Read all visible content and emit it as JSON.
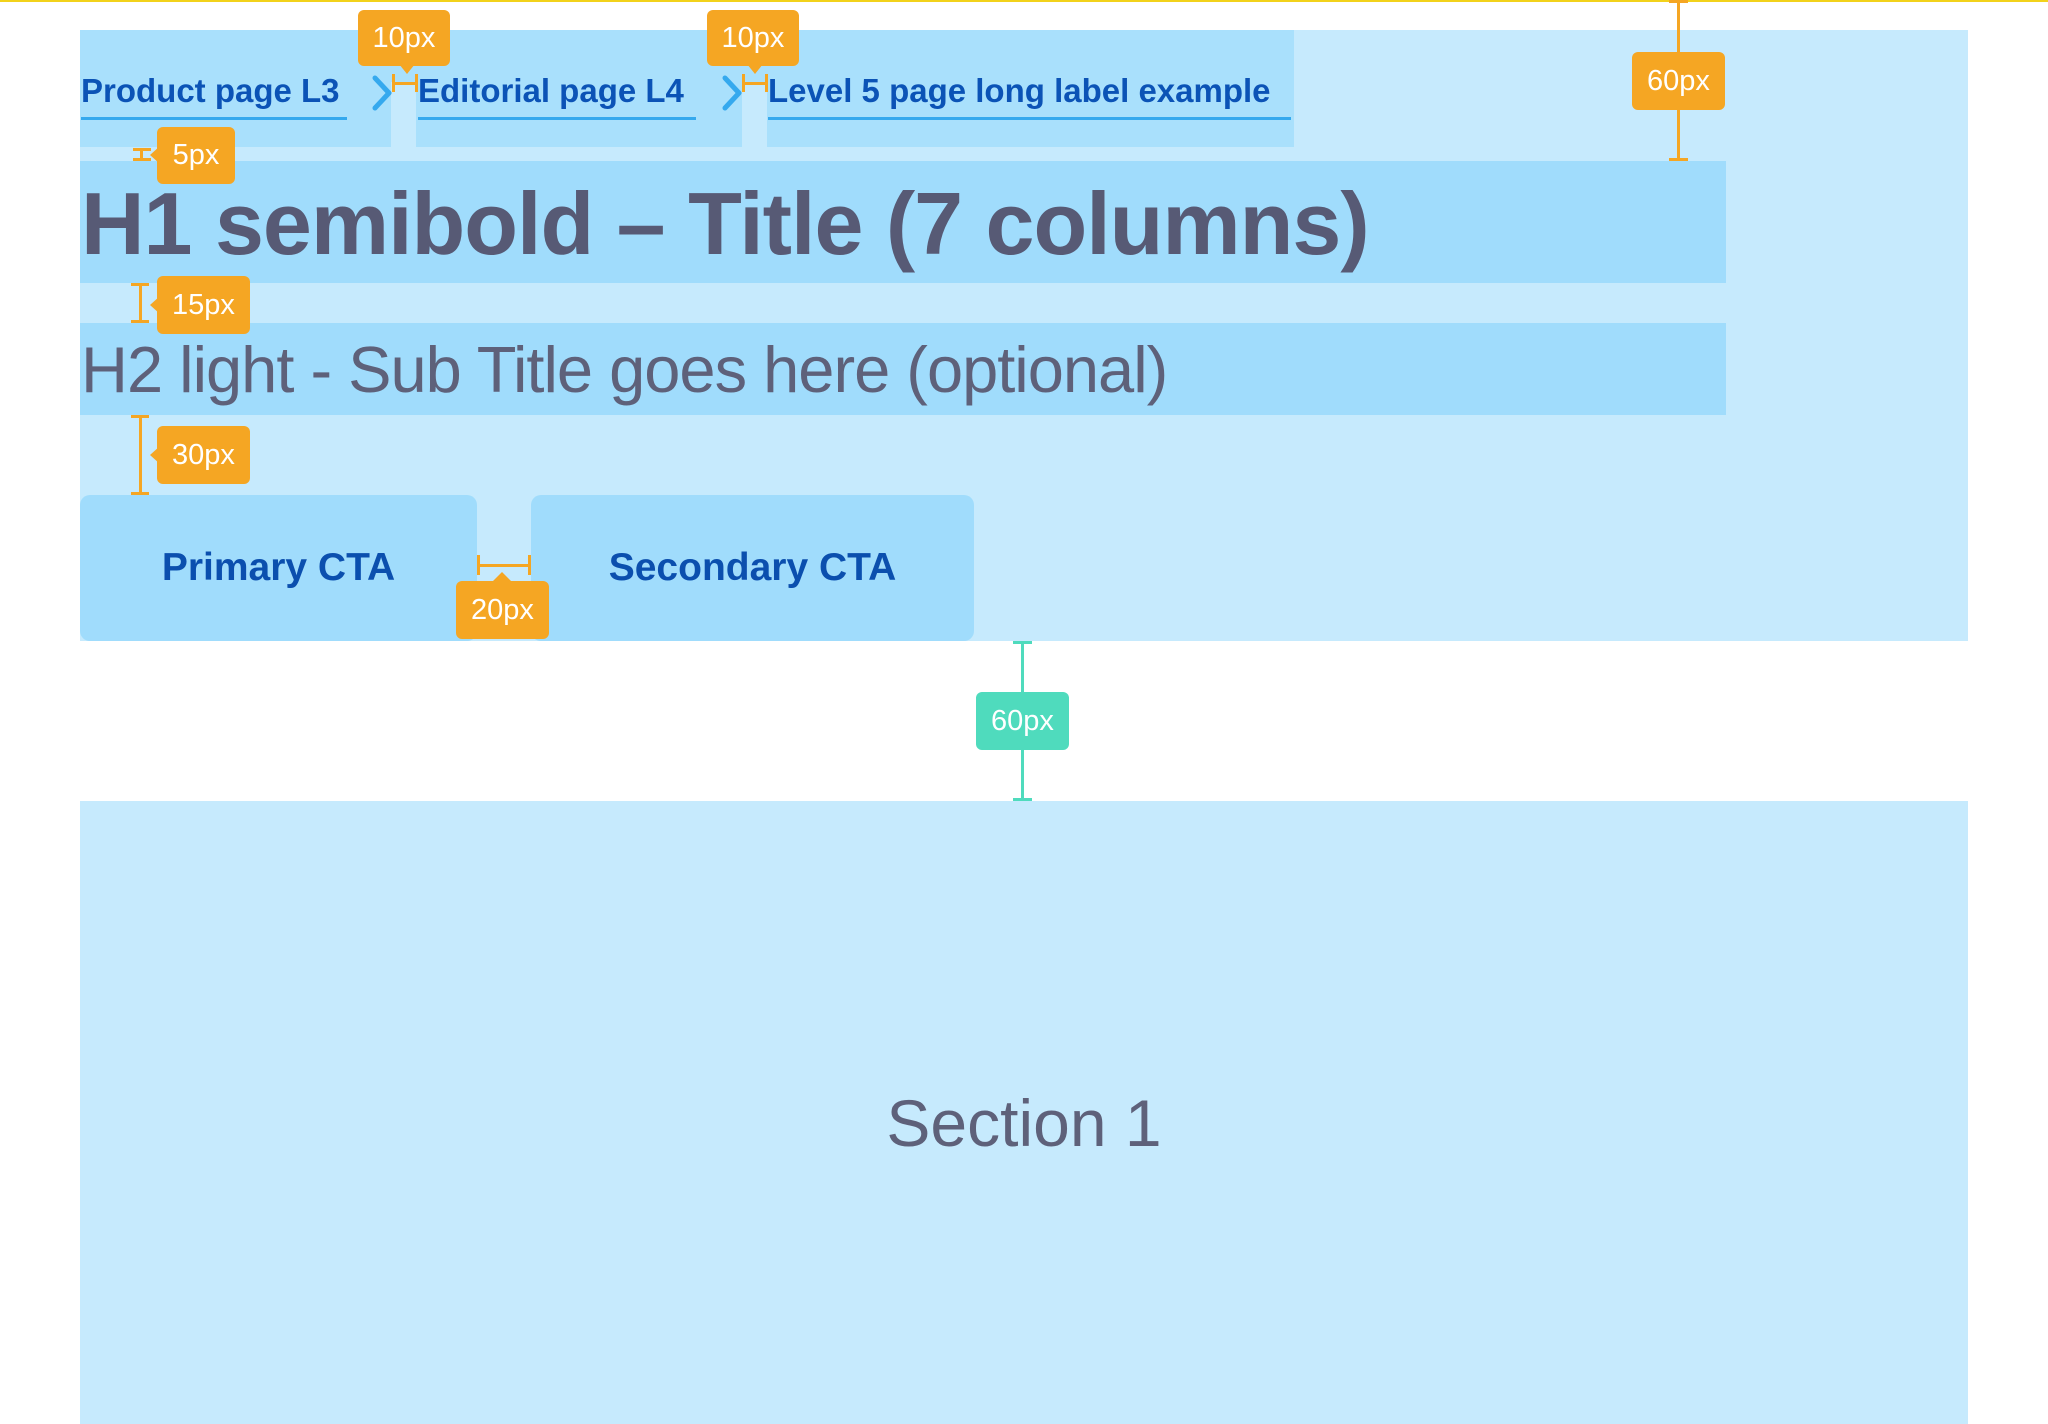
{
  "breadcrumb": {
    "items": [
      {
        "label": "Product page L3"
      },
      {
        "label": "Editorial page L4"
      },
      {
        "label": "Level 5 page long label example"
      }
    ]
  },
  "hero": {
    "title": "H1 semibold – Title (7 columns)",
    "subtitle": "H2 light - Sub Title goes here (optional)",
    "primary_cta": "Primary CTA",
    "secondary_cta": "Secondary CTA"
  },
  "section": {
    "label": "Section 1"
  },
  "spacing_annotations": {
    "crumb_gap_1": "10px",
    "crumb_gap_2": "10px",
    "top_padding": "60px",
    "crumb_to_title": "5px",
    "title_to_subtitle": "15px",
    "subtitle_to_cta": "30px",
    "cta_gap": "20px",
    "hero_to_section": "60px"
  },
  "colors": {
    "link": "#0b53b6",
    "band_light": "#c6eafd",
    "band_mid": "#a0dcfc",
    "annotation_orange": "#f5a623",
    "annotation_green": "#4fdbbd",
    "heading_text": "#575a75"
  }
}
